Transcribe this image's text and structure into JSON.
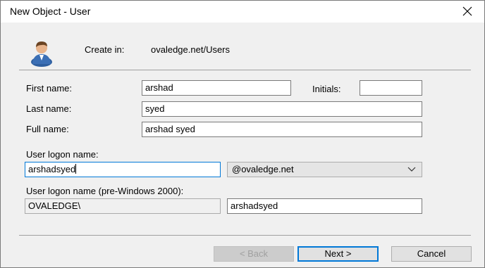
{
  "window": {
    "title": "New Object - User"
  },
  "header": {
    "create_in_label": "Create in:",
    "create_in_value": "ovaledge.net/Users"
  },
  "form": {
    "first_name_label": "First name:",
    "first_name_value": "arshad",
    "initials_label": "Initials:",
    "initials_value": "",
    "last_name_label": "Last name:",
    "last_name_value": "syed",
    "full_name_label": "Full name:",
    "full_name_value": "arshad syed",
    "logon_name_label": "User logon name:",
    "logon_name_value": "arshadsyed",
    "domain_selected": "@ovaledge.net",
    "pre2000_label": "User logon name (pre-Windows 2000):",
    "pre2000_domain_value": "OVALEDGE\\",
    "pre2000_name_value": "arshadsyed"
  },
  "buttons": {
    "back_label": "< Back",
    "next_label": "Next >",
    "cancel_label": "Cancel"
  },
  "icons": {
    "close": "close-icon",
    "user": "user-icon",
    "dropdown": "chevron-down-icon"
  },
  "colors": {
    "focus_border": "#0078d7",
    "window_bg": "#f0f0f0"
  }
}
